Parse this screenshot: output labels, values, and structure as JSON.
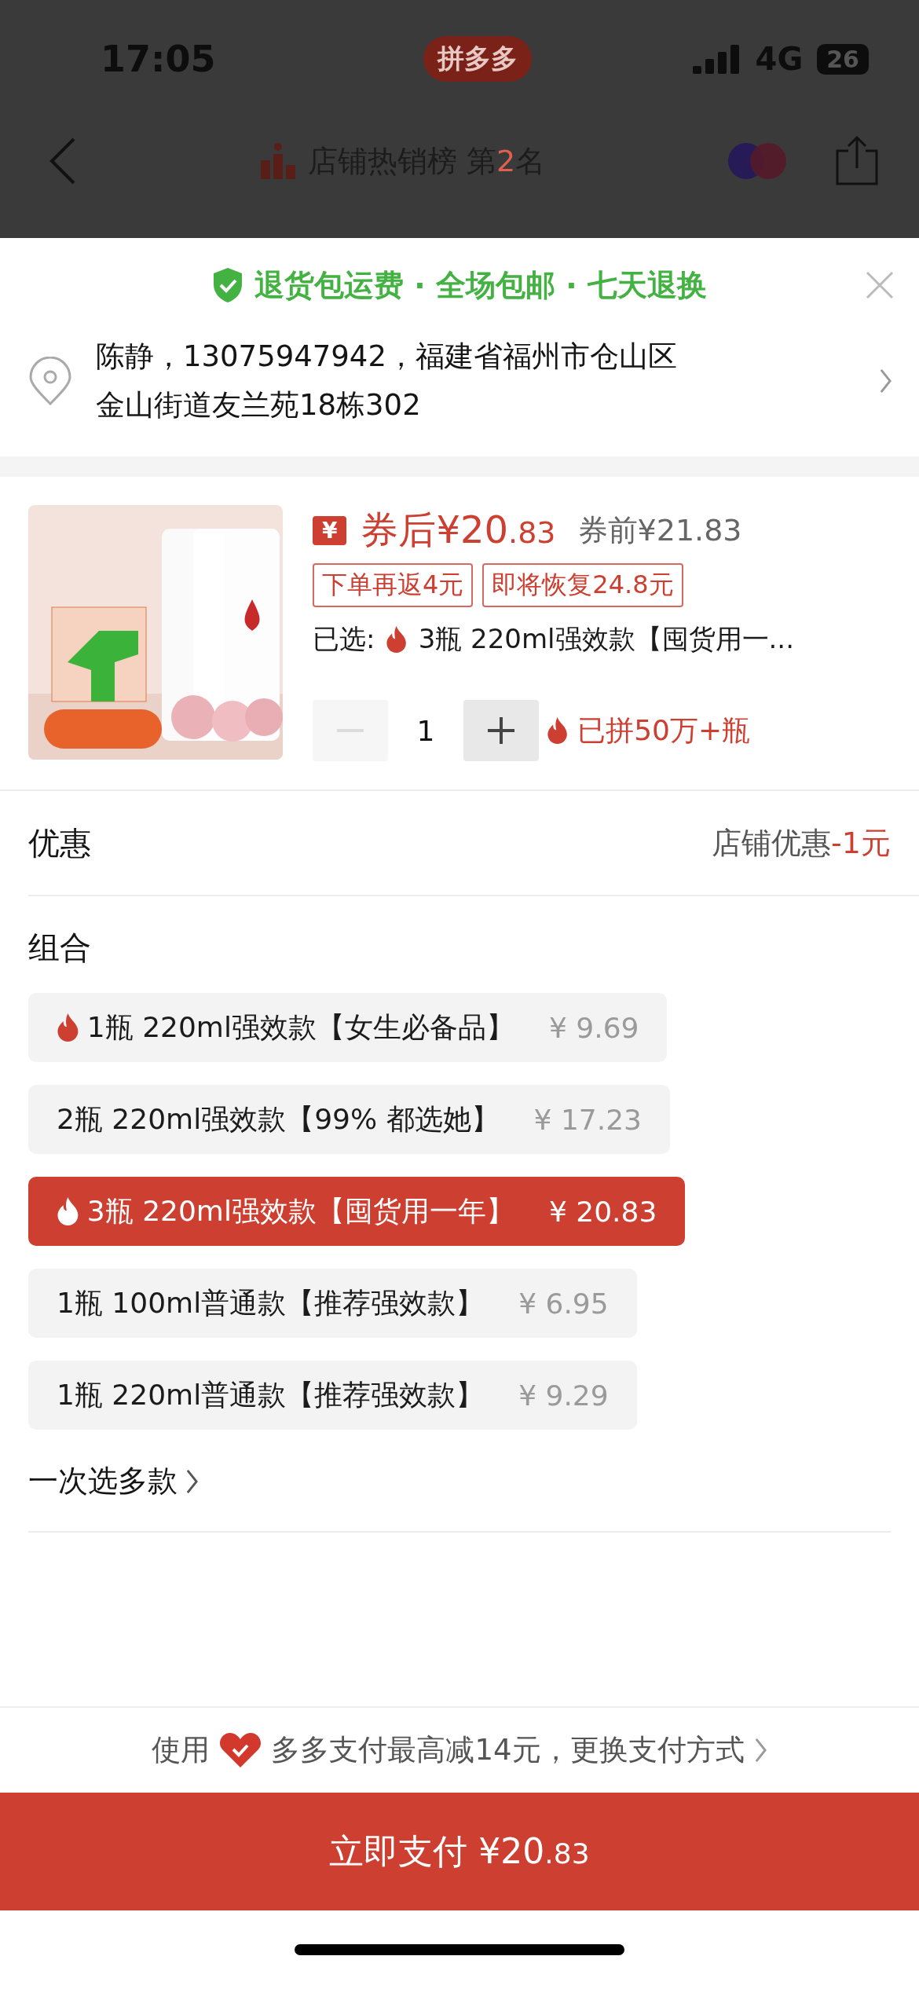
{
  "status_bar": {
    "time": "17:05",
    "app_badge": "拼多多",
    "network": "4G",
    "battery": "26"
  },
  "nav": {
    "ranking_label": "店铺热销榜 第",
    "ranking_number": "2",
    "ranking_suffix": "名"
  },
  "sheet": {
    "guarantee": "退货包运费 · 全场包邮 · 七天退换",
    "address_lines": [
      "陈静，13075947942，福建省福州市仓山区",
      "金山街道友兰苑18栋302"
    ],
    "product": {
      "coupon_badge": "¥",
      "price_main": "券后¥20",
      "price_cents": ".83",
      "original_price": "券前¥21.83",
      "tags": [
        "下单再返4元",
        "即将恢复24.8元"
      ],
      "selected_label": "已选:",
      "selected_value": "3瓶 220ml强效款【囤货用一...",
      "quantity": "1",
      "minus_disabled": true,
      "group_count": "已拼50万+瓶"
    },
    "discount": {
      "label": "优惠",
      "value": "店铺优惠",
      "amount": "-1元"
    },
    "combo": {
      "title": "组合",
      "options": [
        {
          "label": "1瓶 220ml强效款【女生必备品】",
          "price": "¥ 9.69",
          "hot": true,
          "selected": false
        },
        {
          "label": "2瓶 220ml强效款【99% 都选她】",
          "price": "¥ 17.23",
          "hot": false,
          "selected": false
        },
        {
          "label": "3瓶 220ml强效款【囤货用一年】",
          "price": "¥ 20.83",
          "hot": true,
          "selected": true
        },
        {
          "label": "1瓶 100ml普通款【推荐强效款】",
          "price": "¥ 6.95",
          "hot": false,
          "selected": false
        },
        {
          "label": "1瓶 220ml普通款【推荐强效款】",
          "price": "¥ 9.29",
          "hot": false,
          "selected": false
        }
      ]
    },
    "multi_select": "一次选多款",
    "payment_note": {
      "prefix": "使用",
      "text": "多多支付最高减14元，更换支付方式"
    },
    "pay_button": {
      "label": "立即支付 ¥20",
      "cents": ".83"
    }
  }
}
